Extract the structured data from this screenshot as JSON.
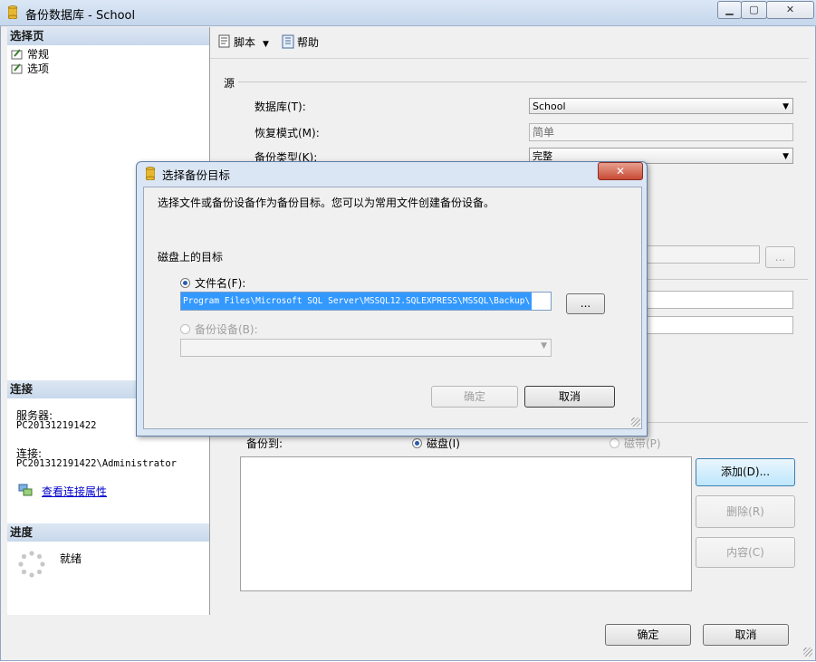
{
  "window": {
    "title": "备份数据库 - School",
    "minimize": "▁",
    "maximize": "▢",
    "close": "✕"
  },
  "left": {
    "select_page_header": "选择页",
    "pages": [
      {
        "label": "常规"
      },
      {
        "label": "选项"
      }
    ],
    "connection_header": "连接",
    "server_label": "服务器:",
    "server_value": "PC201312191422",
    "connection_label": "连接:",
    "connection_value": "PC201312191422\\Administrator",
    "view_props_link": "查看连接属性",
    "progress_header": "进度",
    "progress_status": "就绪"
  },
  "toolbar": {
    "script_label": "脚本",
    "help_label": "帮助"
  },
  "source": {
    "section_label": "源",
    "database_label": "数据库(T):",
    "database_value": "School",
    "recovery_label": "恢复模式(M):",
    "recovery_value": "简单",
    "backup_type_label": "备份类型(K):",
    "backup_type_value": "完整",
    "browse_button": "...",
    "backup_to_label": "备份到:",
    "disk_radio": "磁盘(I)",
    "tape_radio": "磁带(P)",
    "add_button": "添加(D)...",
    "remove_button": "删除(R)",
    "contents_button": "内容(C)"
  },
  "footer": {
    "ok_button": "确定",
    "cancel_button": "取消"
  },
  "dialog": {
    "title": "选择备份目标",
    "close": "✕",
    "description": "选择文件或备份设备作为备份目标。您可以为常用文件创建备份设备。",
    "disk_dest_label": "磁盘上的目标",
    "filename_radio": "文件名(F):",
    "filename_value": "Program Files\\Microsoft SQL Server\\MSSQL12.SQLEXPRESS\\MSSQL\\Backup\\",
    "browse_button": "...",
    "device_radio": "备份设备(B):",
    "ok_button": "确定",
    "cancel_button": "取消"
  }
}
